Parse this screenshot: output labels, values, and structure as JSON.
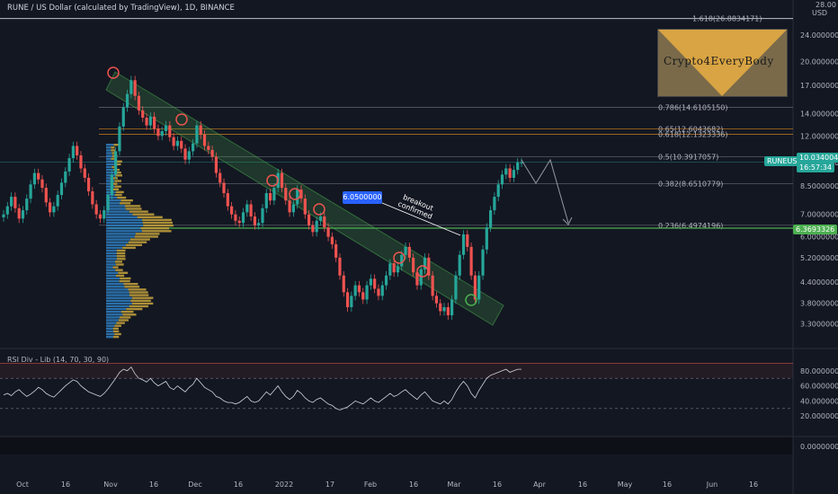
{
  "header": {
    "title": "RUNE / US Dollar (calculated by TradingView), 1D, BINANCE"
  },
  "logo_text": "Crypto4EveryBody",
  "callout": {
    "value": "6.0500000",
    "note_line1": "breakout",
    "note_line2": "confirmed"
  },
  "indicator": {
    "label": "RSI Div - Lib (14, 70, 30, 90)"
  },
  "price_axis": {
    "currency": "USD",
    "top_value": "28.00",
    "ticks": [
      "24.0000000",
      "20.0000000",
      "17.0000000",
      "14.0000000",
      "12.0000000",
      "10.0000000",
      "8.5000000",
      "7.0000000",
      "6.0000000",
      "5.2000000",
      "4.4000000",
      "3.8000000",
      "3.3000000"
    ],
    "symbol_tag": "RUNEUSD",
    "last_price": "10.0340044",
    "countdown": "16:57:34",
    "support_price": "6.3693326"
  },
  "rsi_axis": {
    "ticks": [
      "80.0000000",
      "60.0000000",
      "40.0000000",
      "20.0000000",
      "0.0000000"
    ]
  },
  "time_axis": {
    "ticks": [
      "Oct",
      "16",
      "Nov",
      "16",
      "Dec",
      "16",
      "2022",
      "17",
      "Feb",
      "16",
      "Mar",
      "16",
      "Apr",
      "16",
      "May",
      "16",
      "Jun",
      "16"
    ]
  },
  "fib_levels": [
    {
      "label": "1.618(26.8834171)",
      "color": "#d1d4dc"
    },
    {
      "label": "0.786(14.6105150)",
      "color": "#787b86"
    },
    {
      "label": "0.65(12.6043682)",
      "color": "#f7931a"
    },
    {
      "label": "0.618(12.1323336)",
      "color": "#f7931a"
    },
    {
      "label": "0.5(10.3917057)",
      "color": "#787b86"
    },
    {
      "label": "0.382(8.6510779)",
      "color": "#787b86"
    },
    {
      "label": "0.236(6.4974196)",
      "color": "#787b86"
    }
  ],
  "chart_data": {
    "type": "candlestick",
    "title": "RUNE / US Dollar (calculated by TradingView), 1D, BINANCE",
    "y_scale": "log",
    "ylim": [
      3.0,
      28.0
    ],
    "x_labels": [
      "Oct",
      "16",
      "Nov",
      "16",
      "Dec",
      "16",
      "2022",
      "17",
      "Feb",
      "16",
      "Mar",
      "16",
      "Apr",
      "16",
      "May",
      "16",
      "Jun",
      "16"
    ],
    "close_series": [
      7.0,
      7.4,
      7.9,
      7.3,
      6.8,
      7.2,
      7.8,
      8.6,
      9.3,
      8.9,
      8.4,
      7.6,
      7.1,
      7.4,
      8.0,
      8.7,
      9.4,
      10.3,
      11.2,
      10.5,
      9.6,
      9.0,
      8.2,
      7.5,
      7.0,
      6.8,
      7.2,
      8.0,
      9.2,
      10.8,
      12.8,
      14.6,
      16.0,
      17.6,
      15.8,
      14.3,
      13.6,
      12.9,
      13.7,
      12.6,
      12.0,
      12.4,
      12.9,
      11.9,
      11.2,
      11.6,
      11.0,
      10.2,
      10.8,
      11.4,
      12.9,
      12.1,
      11.2,
      10.9,
      10.4,
      9.3,
      8.7,
      8.1,
      7.4,
      7.0,
      6.7,
      6.6,
      7.1,
      7.5,
      6.9,
      6.5,
      6.6,
      7.3,
      8.1,
      7.7,
      8.4,
      9.3,
      8.4,
      7.7,
      7.1,
      7.5,
      8.3,
      7.8,
      7.0,
      6.5,
      6.2,
      6.7,
      6.9,
      6.4,
      6.0,
      5.7,
      5.2,
      4.6,
      4.1,
      3.7,
      4.0,
      4.3,
      4.1,
      3.9,
      4.3,
      4.5,
      4.2,
      4.0,
      4.3,
      4.6,
      5.0,
      4.7,
      4.9,
      5.3,
      5.6,
      5.2,
      4.7,
      4.3,
      4.8,
      5.2,
      4.6,
      4.0,
      3.8,
      3.6,
      3.7,
      3.5,
      3.9,
      4.6,
      5.3,
      6.1,
      5.6,
      4.6,
      3.9,
      4.6,
      5.5,
      6.4,
      7.2,
      7.9,
      8.6,
      9.2,
      9.6,
      9.0,
      9.5,
      10.0,
      10.0
    ],
    "volume_profile": "horizontal histogram on left (blue/yellow)",
    "rsi": {
      "name": "RSI Div - Lib",
      "ylim": [
        0,
        100
      ],
      "overbought": 70,
      "oversold": 30,
      "values": [
        48,
        50,
        47,
        52,
        55,
        50,
        46,
        49,
        53,
        58,
        55,
        50,
        47,
        45,
        50,
        55,
        60,
        64,
        68,
        66,
        60,
        56,
        52,
        50,
        48,
        46,
        50,
        56,
        63,
        70,
        78,
        82,
        80,
        85,
        76,
        70,
        68,
        65,
        70,
        64,
        60,
        63,
        66,
        58,
        55,
        60,
        56,
        52,
        58,
        62,
        70,
        64,
        58,
        55,
        52,
        46,
        44,
        40,
        38,
        38,
        36,
        38,
        42,
        46,
        40,
        38,
        40,
        46,
        52,
        48,
        54,
        60,
        52,
        46,
        42,
        46,
        54,
        50,
        44,
        40,
        38,
        42,
        44,
        40,
        36,
        34,
        30,
        28,
        30,
        32,
        36,
        40,
        38,
        36,
        40,
        44,
        40,
        38,
        42,
        46,
        50,
        46,
        48,
        52,
        55,
        50,
        46,
        42,
        48,
        52,
        46,
        40,
        38,
        36,
        40,
        36,
        42,
        52,
        60,
        66,
        60,
        50,
        44,
        54,
        62,
        70,
        74,
        76,
        78,
        80,
        82,
        78,
        80,
        82,
        82
      ]
    },
    "annotations": [
      "breakout confirmed",
      "6.0500000"
    ]
  }
}
